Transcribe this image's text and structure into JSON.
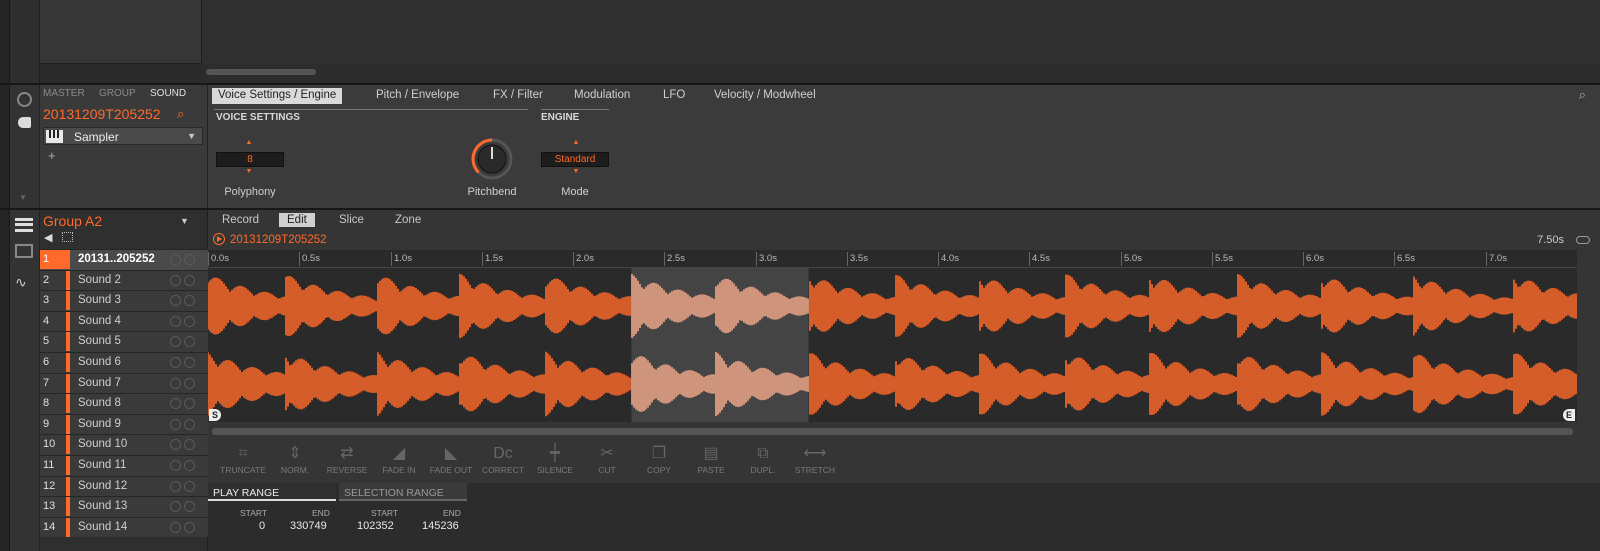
{
  "scope_tabs": [
    "MASTER",
    "GROUP",
    "SOUND"
  ],
  "sound": {
    "name": "20131209T205252",
    "plugin": "Sampler"
  },
  "param_tabs": [
    "Voice Settings / Engine",
    "Pitch / Envelope",
    "FX / Filter",
    "Modulation",
    "LFO",
    "Velocity / Modwheel"
  ],
  "voice_settings": {
    "title": "VOICE SETTINGS",
    "polyphony_value": "8",
    "polyphony_label": "Polyphony",
    "pitchbend_label": "Pitchbend"
  },
  "engine": {
    "title": "ENGINE",
    "mode_value": "Standard",
    "mode_label": "Mode"
  },
  "group": {
    "name": "Group A2"
  },
  "slots": [
    {
      "num": "1",
      "name": "20131..205252",
      "selected": true
    },
    {
      "num": "2",
      "name": "Sound 2"
    },
    {
      "num": "3",
      "name": "Sound 3"
    },
    {
      "num": "4",
      "name": "Sound 4"
    },
    {
      "num": "5",
      "name": "Sound 5"
    },
    {
      "num": "6",
      "name": "Sound 6"
    },
    {
      "num": "7",
      "name": "Sound 7"
    },
    {
      "num": "8",
      "name": "Sound 8"
    },
    {
      "num": "9",
      "name": "Sound 9"
    },
    {
      "num": "10",
      "name": "Sound 10"
    },
    {
      "num": "11",
      "name": "Sound 11"
    },
    {
      "num": "12",
      "name": "Sound 12"
    },
    {
      "num": "13",
      "name": "Sound 13"
    },
    {
      "num": "14",
      "name": "Sound 14"
    }
  ],
  "sampler_tabs": [
    "Record",
    "Edit",
    "Slice",
    "Zone"
  ],
  "sample": {
    "name": "20131209T205252",
    "length": "7.50s",
    "start_marker": "S",
    "end_marker": "E"
  },
  "ruler_ticks": [
    "0.0s",
    "0.5s",
    "1.0s",
    "1.5s",
    "2.0s",
    "2.5s",
    "3.0s",
    "3.5s",
    "4.0s",
    "4.5s",
    "5.0s",
    "5.5s",
    "6.0s",
    "6.5s",
    "7.0s"
  ],
  "ruler_span_seconds": 7.5,
  "selection_seconds": [
    2.32,
    3.29
  ],
  "tools": [
    {
      "label": "TRUNCATE",
      "icon": "truncate-icon"
    },
    {
      "label": "NORM.",
      "icon": "normalize-icon"
    },
    {
      "label": "REVERSE",
      "icon": "reverse-icon"
    },
    {
      "label": "FADE IN",
      "icon": "fade-in-icon"
    },
    {
      "label": "FADE OUT",
      "icon": "fade-out-icon"
    },
    {
      "label": "CORRECT",
      "icon": "dc-correct-icon"
    },
    {
      "label": "SILENCE",
      "icon": "silence-icon"
    },
    {
      "label": "CUT",
      "icon": "scissors-icon"
    },
    {
      "label": "COPY",
      "icon": "copy-icon"
    },
    {
      "label": "PASTE",
      "icon": "paste-icon"
    },
    {
      "label": "DUPL.",
      "icon": "duplicate-icon"
    },
    {
      "label": "STRETCH",
      "icon": "stretch-icon"
    }
  ],
  "play_range": {
    "title": "PLAY RANGE",
    "start_label": "START",
    "end_label": "END",
    "start": "0",
    "end": "330749"
  },
  "selection_range": {
    "title": "SELECTION RANGE",
    "start_label": "START",
    "end_label": "END",
    "start": "102352",
    "end": "145236"
  },
  "colors": {
    "accent": "#ff6a2a",
    "waveform_selected": "#f2a98a",
    "background": "#2b2b2b"
  }
}
